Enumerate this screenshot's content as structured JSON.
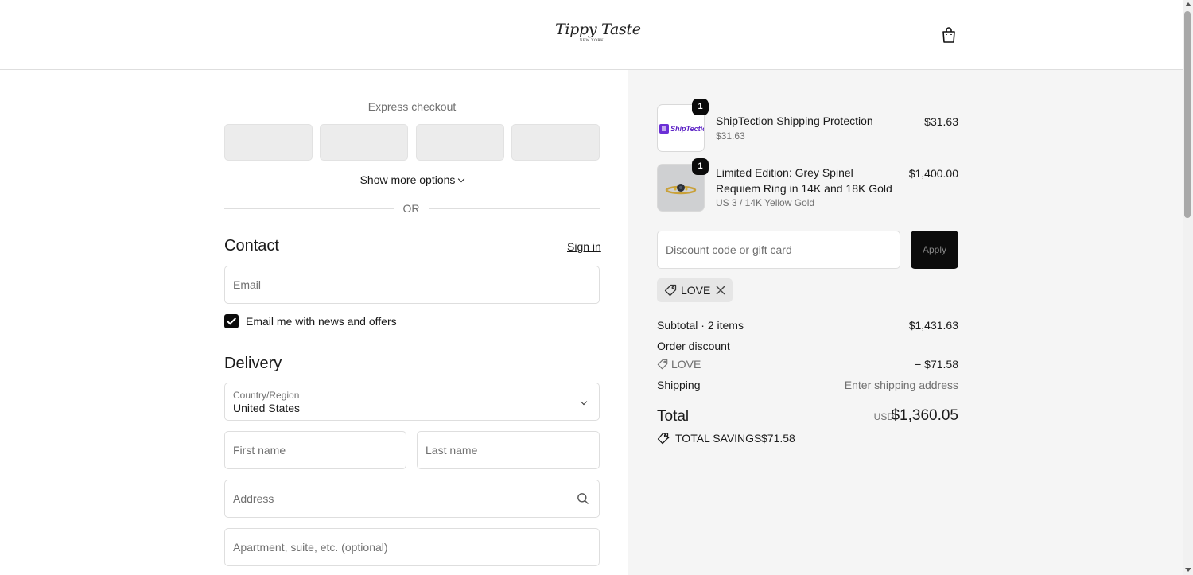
{
  "header": {
    "logo_main": "Tippy Taste",
    "logo_sub": "NEW YORK",
    "cart_icon": "shopping-bag-icon"
  },
  "checkout": {
    "express_title": "Express checkout",
    "show_more": "Show more options",
    "or_divider": "OR",
    "contact": {
      "title": "Contact",
      "sign_in": "Sign in",
      "email_placeholder": "Email",
      "news_label": "Email me with news and offers",
      "news_checked": true
    },
    "delivery": {
      "title": "Delivery",
      "country_label": "Country/Region",
      "country_value": "United States",
      "first_name_placeholder": "First name",
      "last_name_placeholder": "Last name",
      "address_placeholder": "Address",
      "apartment_placeholder": "Apartment, suite, etc. (optional)"
    }
  },
  "summary": {
    "items": [
      {
        "quantity": "1",
        "name": "ShipTection Shipping Protection",
        "sub": "$31.63",
        "price": "$31.63",
        "thumb_label": "ShipTection"
      },
      {
        "quantity": "1",
        "name": "Limited Edition: Grey Spinel Requiem Ring in 14K and 18K Gold",
        "sub": "US 3 / 14K Yellow Gold",
        "price": "$1,400.00"
      }
    ],
    "discount_placeholder": "Discount code or gift card",
    "apply_label": "Apply",
    "applied_code": "LOVE",
    "subtotal_label": "Subtotal · 2 items",
    "subtotal_value": "$1,431.63",
    "order_discount_label": "Order discount",
    "discount_code_label": "LOVE",
    "discount_value": "− $71.58",
    "shipping_label": "Shipping",
    "shipping_value": "Enter shipping address",
    "total_label": "Total",
    "total_currency": "USD",
    "total_value": "$1,360.05",
    "savings_label": "TOTAL SAVINGS",
    "savings_value": "$71.58"
  }
}
